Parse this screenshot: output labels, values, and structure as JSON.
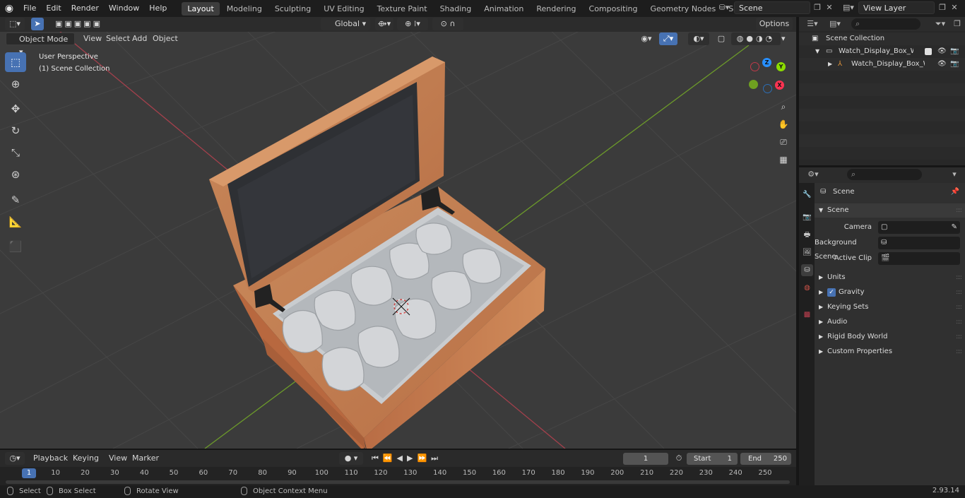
{
  "topbar": {
    "menus": [
      "File",
      "Edit",
      "Render",
      "Window",
      "Help"
    ],
    "workspaces": [
      "Layout",
      "Modeling",
      "Sculpting",
      "UV Editing",
      "Texture Paint",
      "Shading",
      "Animation",
      "Rendering",
      "Compositing",
      "Geometry Nodes",
      "Scripting"
    ],
    "active_workspace": "Layout",
    "scene_name": "Scene",
    "view_layer": "View Layer"
  },
  "viewport_header": {
    "mode": "Object Mode",
    "menus": [
      "View",
      "Select",
      "Add",
      "Object"
    ],
    "transform_orientation": "Global",
    "options": "Options"
  },
  "viewport_overlay": {
    "perspective": "User Perspective",
    "collection": "(1) Scene Collection"
  },
  "gizmo": {
    "axes": [
      "Z",
      "Y",
      "X"
    ],
    "colors": {
      "x": "#ff3352",
      "y": "#8bdc00",
      "z": "#2890ff"
    }
  },
  "outliner": {
    "root": "Scene Collection",
    "collection": "Watch_Display_Box_Wooden_",
    "object": "Watch_Display_Box_Woc"
  },
  "properties": {
    "context": "Scene",
    "panel": "Scene",
    "fields": [
      {
        "label": "Camera",
        "value": ""
      },
      {
        "label": "Background Scene",
        "value": ""
      },
      {
        "label": "Active Clip",
        "value": ""
      }
    ],
    "sections": [
      "Units",
      "Gravity",
      "Keying Sets",
      "Audio",
      "Rigid Body World",
      "Custom Properties"
    ],
    "gravity_checked": true
  },
  "timeline": {
    "menus": [
      "Playback",
      "Keying",
      "View",
      "Marker"
    ],
    "current_frame": "1",
    "start_label": "Start",
    "start": "1",
    "end_label": "End",
    "end": "250",
    "ticks": [
      "1",
      "10",
      "20",
      "30",
      "40",
      "50",
      "60",
      "70",
      "80",
      "90",
      "100",
      "110",
      "120",
      "130",
      "140",
      "150",
      "160",
      "170",
      "180",
      "190",
      "200",
      "210",
      "220",
      "230",
      "240",
      "250"
    ]
  },
  "statusbar": {
    "select": "Select",
    "box_select": "Box Select",
    "rotate": "Rotate View",
    "context_menu": "Object Context Menu",
    "version": "2.93.14"
  }
}
